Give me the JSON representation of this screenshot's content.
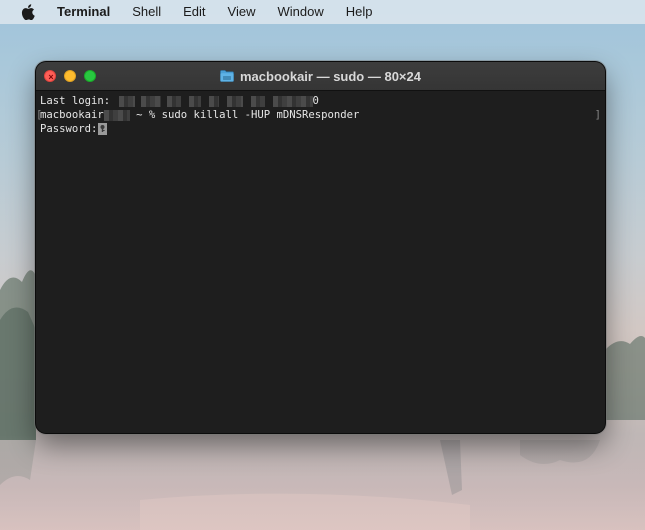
{
  "menubar": {
    "apple_icon": "apple-logo-icon",
    "app_name": "Terminal",
    "items": [
      "Shell",
      "Edit",
      "View",
      "Window",
      "Help"
    ]
  },
  "window": {
    "title": "macbookair — sudo — 80×24",
    "title_icon": "folder-icon",
    "colors": {
      "close": "#fe5f57",
      "minimize": "#febc2e",
      "zoom": "#28c840",
      "background": "#1e1e1e"
    }
  },
  "terminal": {
    "last_login_label": "Last login: ",
    "last_login_suffix": "0",
    "prompt_host": "macbookair",
    "prompt_rest": " ~ % ",
    "command": "sudo killall -HUP mDNSResponder",
    "password_label": "Password:",
    "bracket_left": "[",
    "bracket_right": "]"
  }
}
